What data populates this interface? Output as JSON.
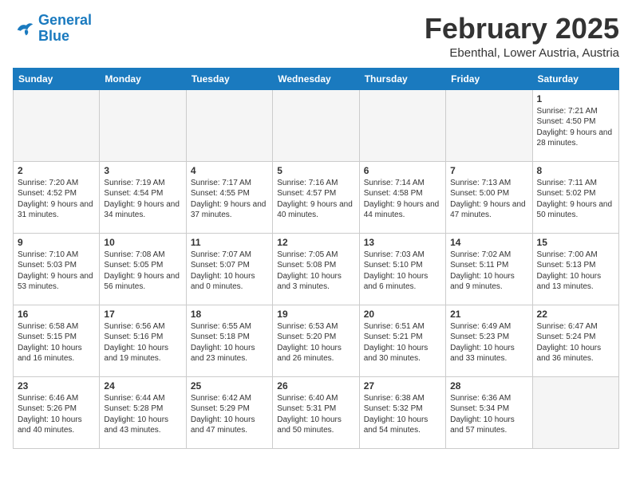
{
  "logo": {
    "line1": "General",
    "line2": "Blue"
  },
  "title": "February 2025",
  "subtitle": "Ebenthal, Lower Austria, Austria",
  "weekdays": [
    "Sunday",
    "Monday",
    "Tuesday",
    "Wednesday",
    "Thursday",
    "Friday",
    "Saturday"
  ],
  "weeks": [
    [
      {
        "day": "",
        "info": ""
      },
      {
        "day": "",
        "info": ""
      },
      {
        "day": "",
        "info": ""
      },
      {
        "day": "",
        "info": ""
      },
      {
        "day": "",
        "info": ""
      },
      {
        "day": "",
        "info": ""
      },
      {
        "day": "1",
        "info": "Sunrise: 7:21 AM\nSunset: 4:50 PM\nDaylight: 9 hours and 28 minutes."
      }
    ],
    [
      {
        "day": "2",
        "info": "Sunrise: 7:20 AM\nSunset: 4:52 PM\nDaylight: 9 hours and 31 minutes."
      },
      {
        "day": "3",
        "info": "Sunrise: 7:19 AM\nSunset: 4:54 PM\nDaylight: 9 hours and 34 minutes."
      },
      {
        "day": "4",
        "info": "Sunrise: 7:17 AM\nSunset: 4:55 PM\nDaylight: 9 hours and 37 minutes."
      },
      {
        "day": "5",
        "info": "Sunrise: 7:16 AM\nSunset: 4:57 PM\nDaylight: 9 hours and 40 minutes."
      },
      {
        "day": "6",
        "info": "Sunrise: 7:14 AM\nSunset: 4:58 PM\nDaylight: 9 hours and 44 minutes."
      },
      {
        "day": "7",
        "info": "Sunrise: 7:13 AM\nSunset: 5:00 PM\nDaylight: 9 hours and 47 minutes."
      },
      {
        "day": "8",
        "info": "Sunrise: 7:11 AM\nSunset: 5:02 PM\nDaylight: 9 hours and 50 minutes."
      }
    ],
    [
      {
        "day": "9",
        "info": "Sunrise: 7:10 AM\nSunset: 5:03 PM\nDaylight: 9 hours and 53 minutes."
      },
      {
        "day": "10",
        "info": "Sunrise: 7:08 AM\nSunset: 5:05 PM\nDaylight: 9 hours and 56 minutes."
      },
      {
        "day": "11",
        "info": "Sunrise: 7:07 AM\nSunset: 5:07 PM\nDaylight: 10 hours and 0 minutes."
      },
      {
        "day": "12",
        "info": "Sunrise: 7:05 AM\nSunset: 5:08 PM\nDaylight: 10 hours and 3 minutes."
      },
      {
        "day": "13",
        "info": "Sunrise: 7:03 AM\nSunset: 5:10 PM\nDaylight: 10 hours and 6 minutes."
      },
      {
        "day": "14",
        "info": "Sunrise: 7:02 AM\nSunset: 5:11 PM\nDaylight: 10 hours and 9 minutes."
      },
      {
        "day": "15",
        "info": "Sunrise: 7:00 AM\nSunset: 5:13 PM\nDaylight: 10 hours and 13 minutes."
      }
    ],
    [
      {
        "day": "16",
        "info": "Sunrise: 6:58 AM\nSunset: 5:15 PM\nDaylight: 10 hours and 16 minutes."
      },
      {
        "day": "17",
        "info": "Sunrise: 6:56 AM\nSunset: 5:16 PM\nDaylight: 10 hours and 19 minutes."
      },
      {
        "day": "18",
        "info": "Sunrise: 6:55 AM\nSunset: 5:18 PM\nDaylight: 10 hours and 23 minutes."
      },
      {
        "day": "19",
        "info": "Sunrise: 6:53 AM\nSunset: 5:20 PM\nDaylight: 10 hours and 26 minutes."
      },
      {
        "day": "20",
        "info": "Sunrise: 6:51 AM\nSunset: 5:21 PM\nDaylight: 10 hours and 30 minutes."
      },
      {
        "day": "21",
        "info": "Sunrise: 6:49 AM\nSunset: 5:23 PM\nDaylight: 10 hours and 33 minutes."
      },
      {
        "day": "22",
        "info": "Sunrise: 6:47 AM\nSunset: 5:24 PM\nDaylight: 10 hours and 36 minutes."
      }
    ],
    [
      {
        "day": "23",
        "info": "Sunrise: 6:46 AM\nSunset: 5:26 PM\nDaylight: 10 hours and 40 minutes."
      },
      {
        "day": "24",
        "info": "Sunrise: 6:44 AM\nSunset: 5:28 PM\nDaylight: 10 hours and 43 minutes."
      },
      {
        "day": "25",
        "info": "Sunrise: 6:42 AM\nSunset: 5:29 PM\nDaylight: 10 hours and 47 minutes."
      },
      {
        "day": "26",
        "info": "Sunrise: 6:40 AM\nSunset: 5:31 PM\nDaylight: 10 hours and 50 minutes."
      },
      {
        "day": "27",
        "info": "Sunrise: 6:38 AM\nSunset: 5:32 PM\nDaylight: 10 hours and 54 minutes."
      },
      {
        "day": "28",
        "info": "Sunrise: 6:36 AM\nSunset: 5:34 PM\nDaylight: 10 hours and 57 minutes."
      },
      {
        "day": "",
        "info": ""
      }
    ]
  ]
}
